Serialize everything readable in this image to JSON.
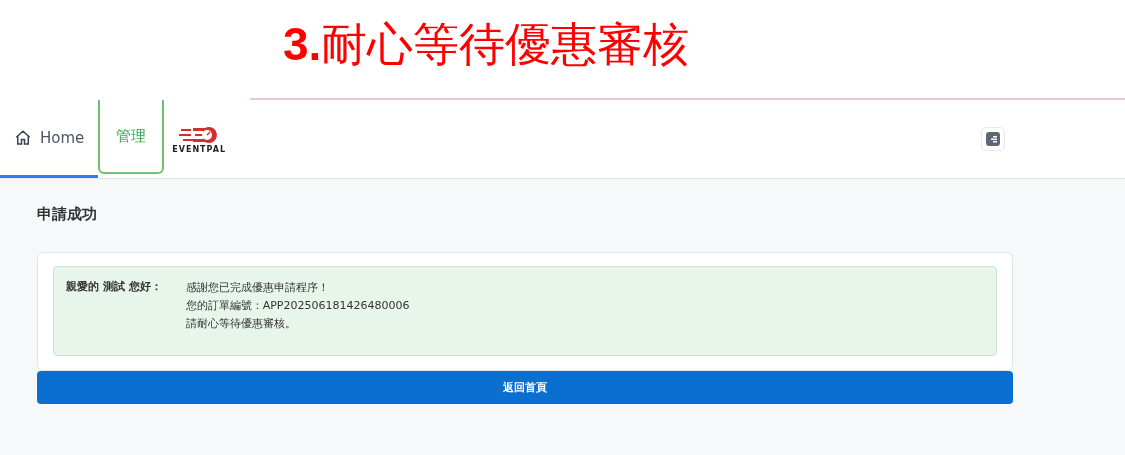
{
  "banner": {
    "title": "**3.**耐心等待優惠審核"
  },
  "nav": {
    "tabs": [
      {
        "label": "Home",
        "kind": "home",
        "selected": true,
        "focused": false
      },
      {
        "label": "管理",
        "kind": "text",
        "selected": false,
        "focused": true
      }
    ],
    "logo": {
      "text": "EVENTPAL"
    }
  },
  "page": {
    "heading": "申請成功",
    "message": {
      "greeting": "親愛的 測試 您好：",
      "lines": [
        "感謝您已完成優惠申請程序！",
        "您的訂單編號：APP202506181426480006",
        "請耐心等待優惠審核。"
      ]
    },
    "button": "返回首頁"
  }
}
